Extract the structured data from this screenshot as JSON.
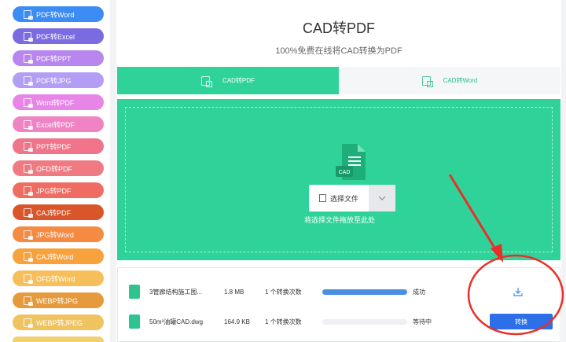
{
  "sidebar": {
    "items": [
      {
        "label": "PDF转Word",
        "color": "#3b8cf5"
      },
      {
        "label": "PDF转Excel",
        "color": "#7b6be0"
      },
      {
        "label": "PDF转PPT",
        "color": "#b886ee"
      },
      {
        "label": "PDF转JPG",
        "color": "#b49ef5"
      },
      {
        "label": "Word转PDF",
        "color": "#e886e8"
      },
      {
        "label": "Excel转PDF",
        "color": "#f083c4"
      },
      {
        "label": "PPT转PDF",
        "color": "#f0748a"
      },
      {
        "label": "OFD转PDF",
        "color": "#f07a82"
      },
      {
        "label": "JPG转PDF",
        "color": "#f06c62"
      },
      {
        "label": "CAJ转PDF",
        "color": "#d9562b"
      },
      {
        "label": "JPG转Word",
        "color": "#f58a43"
      },
      {
        "label": "CAJ转Word",
        "color": "#f7a23c"
      },
      {
        "label": "OFD转Word",
        "color": "#f7bf5b"
      },
      {
        "label": "WEBP转JPG",
        "color": "#e69a3c"
      },
      {
        "label": "WEBP转JPEG",
        "color": "#f0c361"
      }
    ]
  },
  "main": {
    "title": "CAD转PDF",
    "subtitle": "100%免费在线将CAD转换为PDF",
    "tabs": [
      {
        "label": "CAD转PDF",
        "active": true
      },
      {
        "label": "CAD转Word",
        "active": false
      }
    ],
    "dropzone": {
      "icon_label": "CAD",
      "select_label": "选择文件",
      "hint": "将选择文件拖放至此处"
    },
    "files": [
      {
        "name": "3管廊结构施工图...",
        "size": "1.8 MB",
        "count": "1 个转换次数",
        "progress": 1.0,
        "status": "成功",
        "action": "download-icon"
      },
      {
        "name": "50m³油罐CAD.dwg",
        "size": "164.9 KB",
        "count": "1 个转换次数",
        "progress": 0.0,
        "status": "等待中",
        "action_label": "转换"
      }
    ]
  },
  "colors": {
    "accent_green": "#2fd39a",
    "button_blue": "#2d6fe8",
    "progress_blue": "#4a90e2",
    "annotation_red": "#e8302a"
  }
}
